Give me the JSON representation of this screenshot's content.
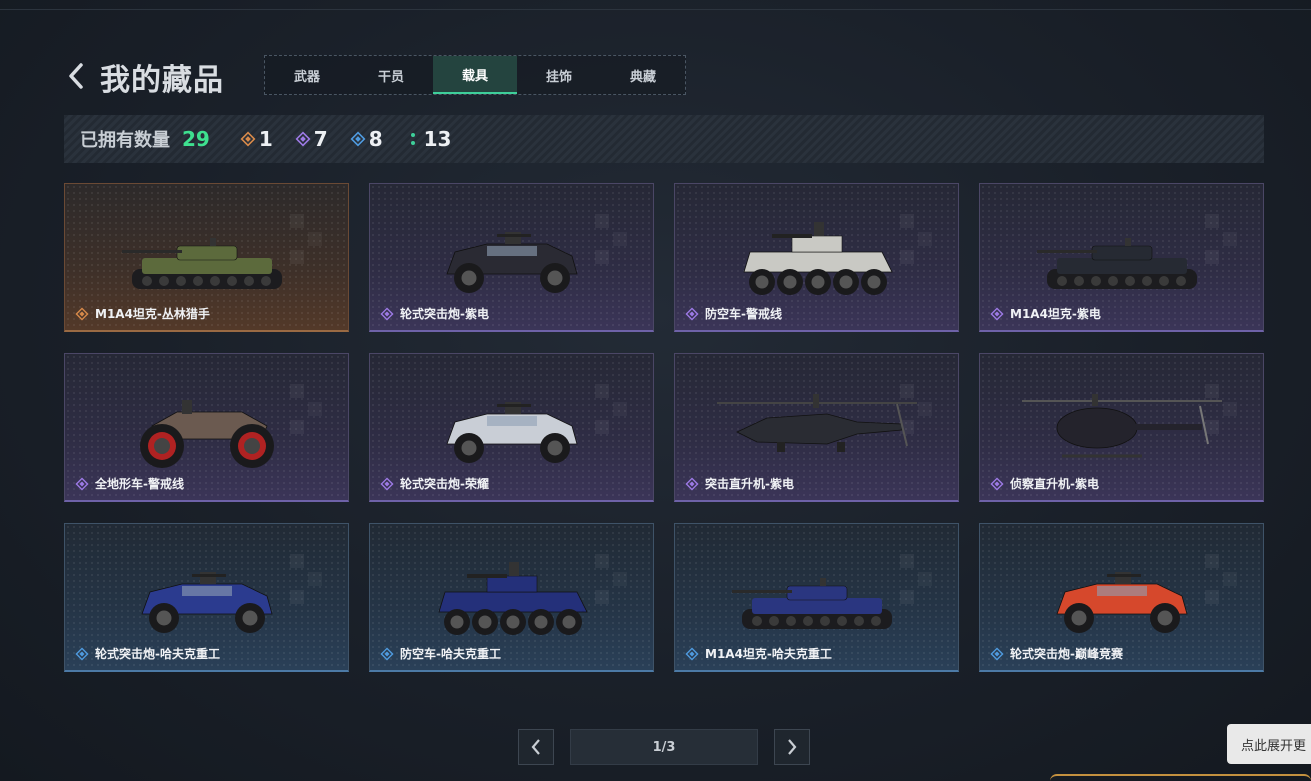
{
  "header": {
    "title": "我的藏品",
    "back_icon": "chevron-left-icon"
  },
  "tabs": [
    {
      "label": "武器",
      "active": false
    },
    {
      "label": "干员",
      "active": false
    },
    {
      "label": "载具",
      "active": true
    },
    {
      "label": "挂饰",
      "active": false
    },
    {
      "label": "典藏",
      "active": false
    }
  ],
  "stats": {
    "owned_label": "已拥有数量",
    "owned_total": "29",
    "counts": [
      {
        "rarity": "orange",
        "icon": "diamond-icon",
        "color": "#d88a4a",
        "value": "1"
      },
      {
        "rarity": "purple",
        "icon": "diamond-icon",
        "color": "#9d7ae6",
        "value": "7"
      },
      {
        "rarity": "blue",
        "icon": "diamond-icon",
        "color": "#4f9be0",
        "value": "8"
      },
      {
        "rarity": "green",
        "icon": "dots-icon",
        "color": "#3ecf9a",
        "value": "13"
      }
    ]
  },
  "items": [
    {
      "name": "M1A4坦克-丛林猎手",
      "rarity": "orange",
      "icon": "tank-icon",
      "color": "#5c6a3c"
    },
    {
      "name": "轮式突击炮-紫电",
      "rarity": "purple",
      "icon": "armored-car-icon",
      "color": "#2a2a33"
    },
    {
      "name": "防空车-警戒线",
      "rarity": "purple",
      "icon": "apc-icon",
      "color": "#c9c9c4"
    },
    {
      "name": "M1A4坦克-紫电",
      "rarity": "purple",
      "icon": "tank-icon",
      "color": "#262a33"
    },
    {
      "name": "全地形车-警戒线",
      "rarity": "purple",
      "icon": "atv-icon",
      "color": "#6b5a50"
    },
    {
      "name": "轮式突击炮-荣耀",
      "rarity": "purple",
      "icon": "armored-car-icon",
      "color": "#c9ced6"
    },
    {
      "name": "突击直升机-紫电",
      "rarity": "purple",
      "icon": "attack-helicopter-icon",
      "color": "#2a2c33"
    },
    {
      "name": "侦察直升机-紫电",
      "rarity": "purple",
      "icon": "scout-helicopter-icon",
      "color": "#24232c"
    },
    {
      "name": "轮式突击炮-哈夫克重工",
      "rarity": "blue",
      "icon": "armored-car-icon",
      "color": "#2b3b8f"
    },
    {
      "name": "防空车-哈夫克重工",
      "rarity": "blue",
      "icon": "apc-icon",
      "color": "#24307a"
    },
    {
      "name": "M1A4坦克-哈夫克重工",
      "rarity": "blue",
      "icon": "tank-icon",
      "color": "#2a3680"
    },
    {
      "name": "轮式突击炮-巅峰竞赛",
      "rarity": "blue",
      "icon": "armored-car-icon",
      "color": "#d6482c"
    }
  ],
  "pagination": {
    "page_text": "1/3",
    "prev_icon": "chevron-left-icon",
    "next_icon": "chevron-right-icon"
  },
  "expand_button": {
    "label": "点此展开更"
  }
}
